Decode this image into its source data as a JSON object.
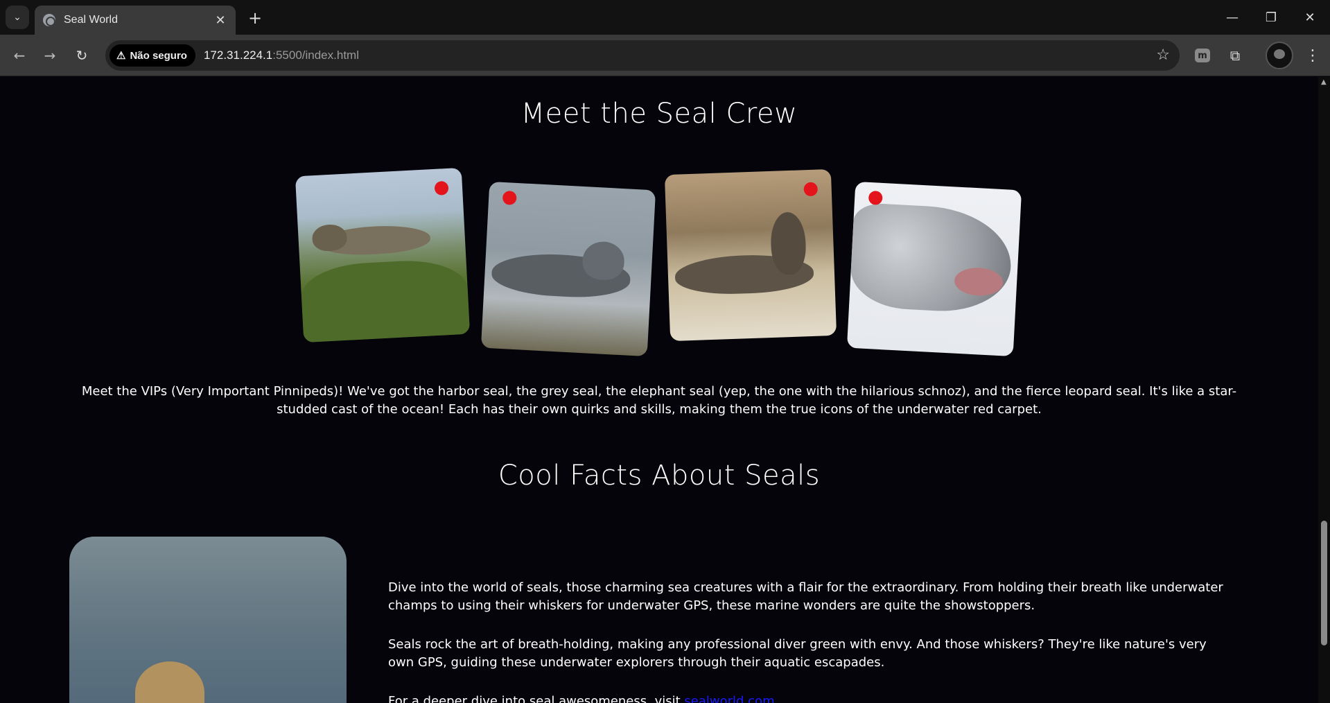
{
  "browser": {
    "tab_title": "Seal World",
    "security_label": "Não seguro",
    "url_host": "172.31.224.1",
    "url_path": ":5500/index.html"
  },
  "crew_section": {
    "title": "Meet the Seal Crew",
    "description": "Meet the VIPs (Very Important Pinnipeds)! We've got the harbor seal, the grey seal, the elephant seal (yep, the one with the hilarious schnoz), and the fierce leopard seal. It's like a star-studded cast of the ocean! Each has their own quirks and skills, making them the true icons of the underwater red carpet."
  },
  "facts_section": {
    "title": "Cool Facts About Seals",
    "paragraph_1": "Dive into the world of seals, those charming sea creatures with a flair for the extraordinary. From holding their breath like underwater champs to using their whiskers for underwater GPS, these marine wonders are quite the showstoppers.",
    "paragraph_2": "Seals rock the art of breath-holding, making any professional diver green with envy. And those whiskers? They're like nature's very own GPS, guiding these underwater explorers through their aquatic escapades.",
    "paragraph_3_prefix": "For a deeper dive into seal awesomeness, visit ",
    "link_text": "sealworld.com"
  }
}
